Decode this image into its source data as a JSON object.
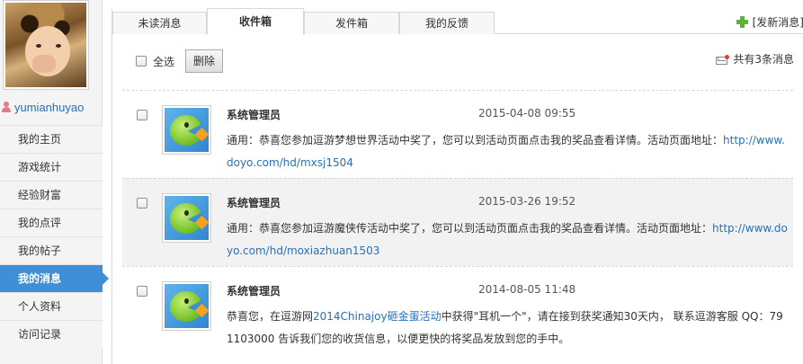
{
  "sidebar": {
    "username": "yumianhuyao",
    "items": [
      {
        "label": "我的主页",
        "active": false
      },
      {
        "label": "游戏统计",
        "active": false
      },
      {
        "label": "经验财富",
        "active": false
      },
      {
        "label": "我的点评",
        "active": false
      },
      {
        "label": "我的帖子",
        "active": false
      },
      {
        "label": "我的消息",
        "active": true
      },
      {
        "label": "个人资料",
        "active": false
      },
      {
        "label": "访问记录",
        "active": false
      }
    ]
  },
  "tabs": [
    {
      "label": "未读消息",
      "active": false
    },
    {
      "label": "收件箱",
      "active": true
    },
    {
      "label": "发件箱",
      "active": false
    },
    {
      "label": "我的反馈",
      "active": false
    }
  ],
  "new_message_label": "[发新消息]",
  "toolbar": {
    "select_all_label": "全选",
    "delete_label": "删除",
    "total_label": "共有3条消息"
  },
  "messages": [
    {
      "sender": "系统管理员",
      "time": "2015-04-08 09:55",
      "text": "通用：恭喜您参加逗游梦想世界活动中奖了，您可以到活动页面点击我的奖品查看详情。活动页面地址：",
      "link": "http://www.doyo.com/hd/mxsj1504",
      "link_text_2": "",
      "text_2": "",
      "alt": false
    },
    {
      "sender": "系统管理员",
      "time": "2015-03-26 19:52",
      "text": "通用：恭喜您参加逗游魔侠传活动中奖了，您可以到活动页面点击我的奖品查看详情。活动页面地址：",
      "link": "http://www.doyo.com/hd/moxiazhuan1503",
      "link_text_2": "",
      "text_2": "",
      "alt": true
    },
    {
      "sender": "系统管理员",
      "time": "2014-08-05 11:48",
      "text": "恭喜您，在逗游网",
      "link": "2014Chinajoy砸金蛋活动",
      "link_text_2": "",
      "text_2": "中获得\"耳机一个\"，请在接到获奖通知30天内， 联系逗游客服 QQ：791103000 告诉我们您的收货信息，以便更快的将奖品发放到您的手中。",
      "alt": false
    }
  ],
  "colors": {
    "accent": "#3f8fd6",
    "link": "#2a6fb8",
    "plus": "#5cb531"
  }
}
